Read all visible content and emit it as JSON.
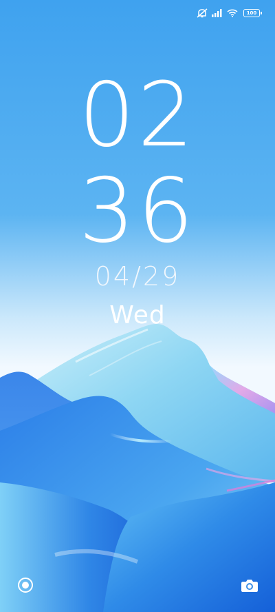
{
  "status_bar": {
    "icons": [
      "mute-icon",
      "signal-icon",
      "wifi-icon",
      "battery-icon"
    ],
    "battery_level": "100"
  },
  "lockscreen": {
    "hours": "02",
    "minutes": "36",
    "date": "04/29",
    "weekday": "Wed"
  },
  "shortcuts": {
    "left_icon": "assistant-icon",
    "right_icon": "camera-icon"
  },
  "colors": {
    "sky_top": "#3fa3f0",
    "sky_bottom": "#eef8fe",
    "mountain_light": "#8fd6f2",
    "mountain_deep": "#1a6fe0",
    "accent_pink": "#f08ad8"
  }
}
